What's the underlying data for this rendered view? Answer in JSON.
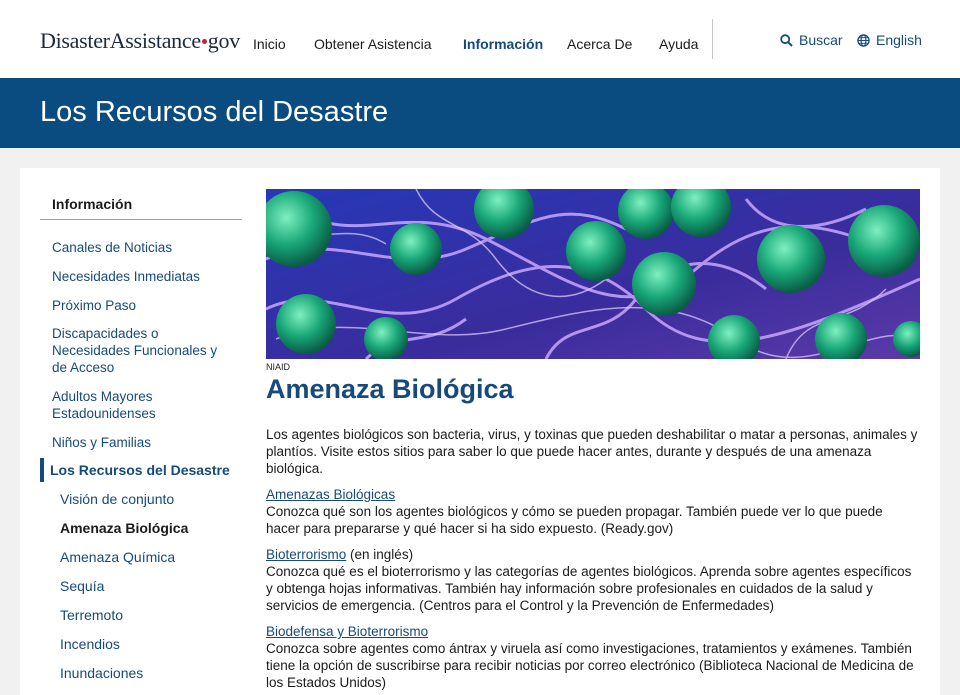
{
  "header": {
    "logo": {
      "part1": "Disaster",
      "part2": "Assistance",
      "part3": "gov"
    },
    "nav": [
      "Inicio",
      "Obtener Asistencia",
      "Información",
      "Acerca De",
      "Ayuda"
    ],
    "search_label": "Buscar",
    "language_label": "English"
  },
  "banner": {
    "title": "Los Recursos del Desastre"
  },
  "sidebar": {
    "heading": "Información",
    "items": [
      "Canales de Noticias",
      "Necesidades Inmediatas",
      "Próximo Paso",
      "Discapacidades o Necesidades Funcionales y de Acceso",
      "Adultos Mayores Estadounidenses",
      "Niños y Familias"
    ],
    "active_section": "Los Recursos del Desastre",
    "subitems": [
      "Visión de conjunto",
      "Amenaza Biológica",
      "Amenaza Química",
      "Sequía",
      "Terremoto",
      "Incendios",
      "Inundaciones"
    ]
  },
  "article": {
    "image_credit": "NIAID",
    "title": "Amenaza Biológica",
    "intro": "Los agentes biológicos son bacteria, virus, y toxinas que pueden deshabilitar o matar a personas, animales y plantíos. Visite estos sitios para saber lo que puede hacer antes, durante y después de una amenaza biológica.",
    "resources": [
      {
        "link": "Amenazas Biológicas",
        "note": "",
        "text": "Conozca qué son los agentes biológicos y cómo se pueden propagar. También puede ver lo que puede hacer para prepararse y qué hacer si ha sido expuesto. (Ready.gov)"
      },
      {
        "link": "Bioterrorismo",
        "note": " (en inglés)",
        "text": "Conozca qué es el bioterrorismo y las categorías de agentes biológicos. Aprenda sobre agentes específicos y obtenga hojas informativas. También hay información sobre profesionales en cuidados de la salud y servicios de emergencia. (Centros para el Control y la Prevención de Enfermedades)"
      },
      {
        "link": "Biodefensa y Bioterrorismo",
        "note": "",
        "text": "Conozca sobre agentes como ántrax y viruela así como investigaciones, tratamientos y exámenes. También tiene la opción de suscribirse para recibir noticias por correo electrónico (Biblioteca Nacional de Medicina de los Estados Unidos)"
      }
    ]
  },
  "colors": {
    "banner": "#0b4c80",
    "link": "#174a7c",
    "logo_dot": "#c0272d",
    "page_bg": "#f1f1f1"
  }
}
